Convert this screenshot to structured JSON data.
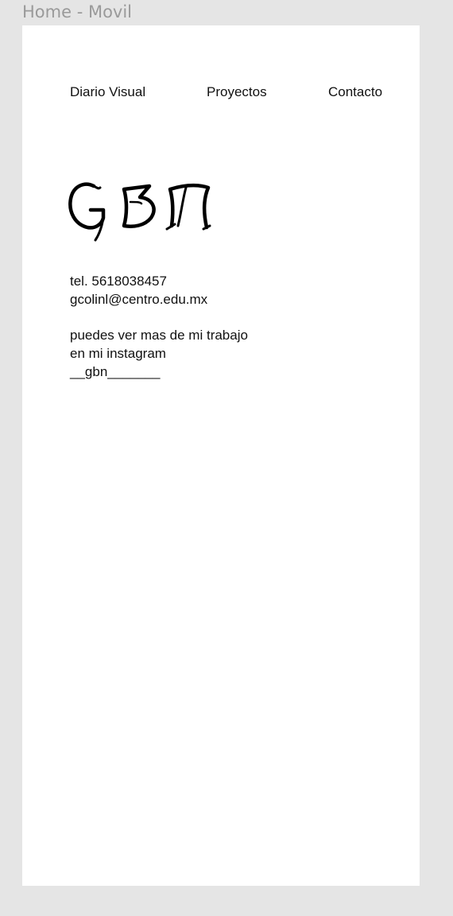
{
  "frame": {
    "label": "Home - Movil"
  },
  "nav": {
    "items": [
      {
        "label": "Diario Visual"
      },
      {
        "label": "Proyectos"
      },
      {
        "label": "Contacto"
      }
    ]
  },
  "logo": {
    "text": "GBN",
    "icon": "gbn-logo-blackletter"
  },
  "contact": {
    "phone": "tel. 5618038457",
    "email": "gcolinl@centro.edu.mx",
    "instagram_line1": "puedes ver mas de mi trabajo",
    "instagram_line2": "en mi instagram",
    "instagram_handle": "__gbn_______"
  },
  "colors": {
    "canvas": "#e5e5e5",
    "frame": "#ffffff",
    "text": "#111111",
    "label": "#9a9a9a"
  }
}
